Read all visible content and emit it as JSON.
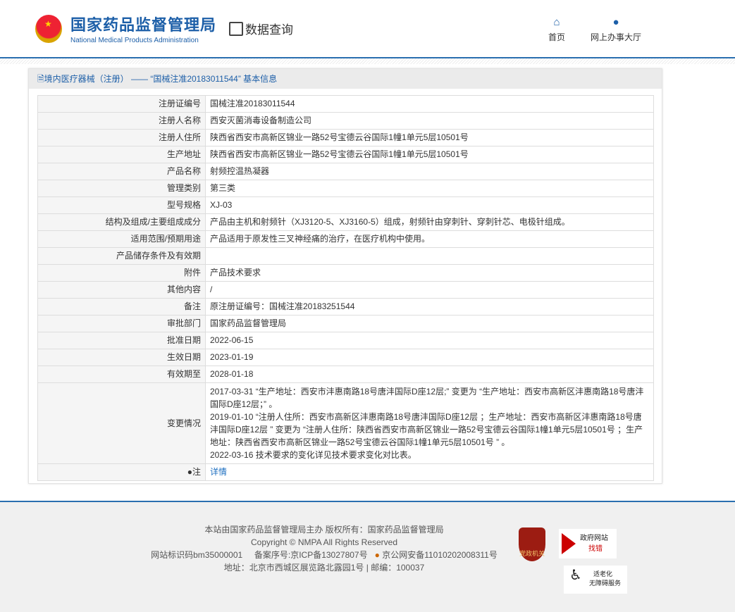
{
  "header": {
    "logo_cn": "国家药品监督管理局",
    "logo_en": "National Medical Products Administration",
    "section": "数据查询",
    "nav": [
      {
        "label": "首页",
        "icon": "home-icon"
      },
      {
        "label": "网上办事大厅",
        "icon": "user-icon"
      }
    ]
  },
  "panel": {
    "title": "境内医疗器械（注册） —— “国械注准20183011544” 基本信息"
  },
  "rows": [
    {
      "label": "注册证编号",
      "value": "国械注准20183011544"
    },
    {
      "label": "注册人名称",
      "value": "西安灭菌消毒设备制造公司"
    },
    {
      "label": "注册人住所",
      "value": "陕西省西安市高新区锦业一路52号宝德云谷国际1幢1单元5层10501号"
    },
    {
      "label": "生产地址",
      "value": "陕西省西安市高新区锦业一路52号宝德云谷国际1幢1单元5层10501号"
    },
    {
      "label": "产品名称",
      "value": "射频控温热凝器"
    },
    {
      "label": "管理类别",
      "value": "第三类"
    },
    {
      "label": "型号规格",
      "value": "XJ-03"
    },
    {
      "label": "结构及组成/主要组成成分",
      "value": "产品由主机和射频针（XJ3120-5、XJ3160-5）组成，射频针由穿刺针、穿刺针芯、电极针组成。"
    },
    {
      "label": "适用范围/预期用途",
      "value": "产品适用于原发性三叉神经痛的治疗，在医疗机构中使用。"
    },
    {
      "label": "产品储存条件及有效期",
      "value": ""
    },
    {
      "label": "附件",
      "value": "产品技术要求"
    },
    {
      "label": "其他内容",
      "value": "/"
    },
    {
      "label": "备注",
      "value": "原注册证编号：国械注准20183251544"
    },
    {
      "label": "审批部门",
      "value": "国家药品监督管理局"
    },
    {
      "label": "批准日期",
      "value": "2022-06-15"
    },
    {
      "label": "生效日期",
      "value": "2023-01-19"
    },
    {
      "label": "有效期至",
      "value": "2028-01-18"
    }
  ],
  "changes": {
    "label": "变更情况",
    "lines": [
      "2017-03-31 “生产地址：西安市沣惠南路18号唐沣国际D座12层;” 变更为 “生产地址：西安市高新区沣惠南路18号唐沣国际D座12层；” 。",
      "2019-01-10 “注册人住所：西安市高新区沣惠南路18号唐沣国际D座12层 ；生产地址：西安市高新区沣惠南路18号唐沣国际D座12层 ” 变更为 “注册人住所：陕西省西安市高新区锦业一路52号宝德云谷国际1幢1单元5层10501号 ；生产地址：陕西省西安市高新区锦业一路52号宝德云谷国际1幢1单元5层10501号 ” 。",
      "2022-03-16 技术要求的变化详见技术要求变化对比表。"
    ]
  },
  "note": {
    "label": "注",
    "link": "详情"
  },
  "footer": {
    "line1": "本站由国家药品监督管理局主办 版权所有：国家药品监督管理局",
    "line2": "Copyright © NMPA All Rights Reserved",
    "site_id": "网站标识码bm35000001",
    "icp": "备案序号:京ICP备13027807号",
    "police": "京公网安备11010202008311号",
    "address": "地址：北京市西城区展览路北露园1号 | 邮编：100037",
    "badge1": "党政机关",
    "badge2_top": "政府网站",
    "badge2_bottom": "找错",
    "badge3_top": "适老化",
    "badge3_bottom": "无障碍服务"
  }
}
